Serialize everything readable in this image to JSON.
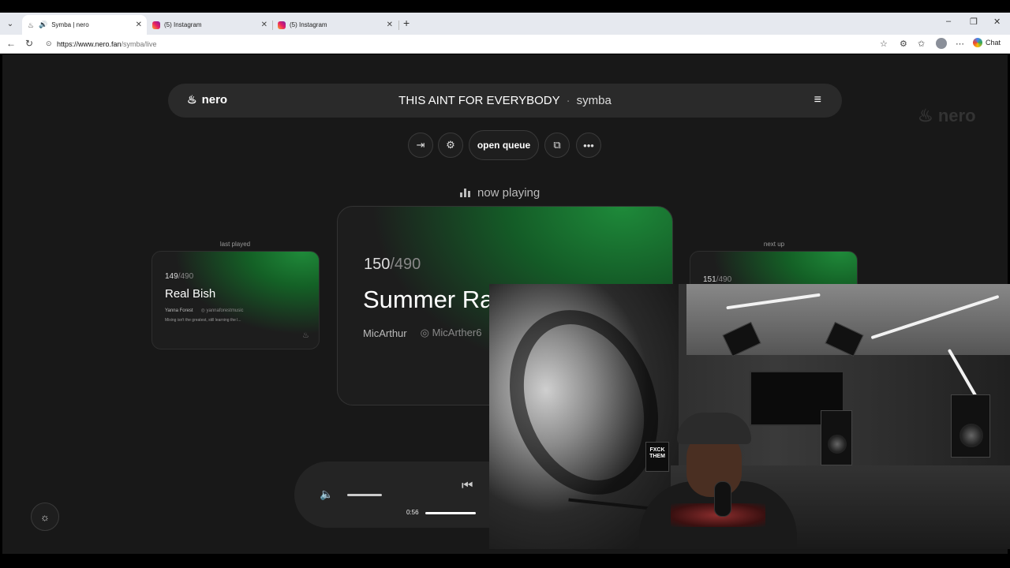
{
  "browser": {
    "tabs": [
      {
        "title": "Symba | nero",
        "active": true
      },
      {
        "title": "(5) Instagram",
        "active": false
      },
      {
        "title": "(5) Instagram",
        "active": false
      }
    ],
    "url_domain": "https://www.nero.fan",
    "url_path": "/symba/live",
    "chat_label": "Chat"
  },
  "header": {
    "brand": "nero",
    "song_title": "THIS AINT FOR EVERYBODY",
    "separator": "·",
    "artist": "symba",
    "ghost_logo": "nero"
  },
  "controls": {
    "queue_label": "open queue"
  },
  "now_playing_label": "now playing",
  "last_played": {
    "label": "last played",
    "count": "149",
    "total": "/490",
    "title": "Real Bish",
    "author": "Yanna Forest",
    "handle": "yannaforestmusic",
    "desc": "Mixing isn't the greatest, still learning the l..."
  },
  "current": {
    "count": "150",
    "total": "/490",
    "title": "Summer Ra",
    "author": "MicArthur",
    "handle": "MicArther6"
  },
  "next_up": {
    "label": "next up",
    "count": "151",
    "total": "/490"
  },
  "player": {
    "time_current": "0:56",
    "volume_level": 1.0,
    "progress_fraction": 0.29
  },
  "webcam": {
    "box_text": "FXCK THEM"
  },
  "colors": {
    "page_bg": "#181818",
    "accent_green": "#1e8a3a"
  }
}
